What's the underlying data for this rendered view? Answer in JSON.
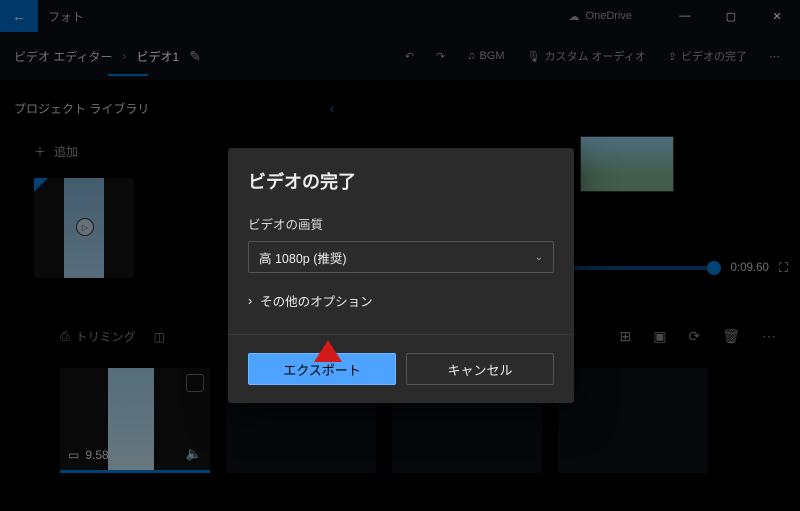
{
  "titlebar": {
    "app_name": "フォト",
    "onedrive_label": "OneDrive"
  },
  "breadcrumb": {
    "root": "ビデオ エディター",
    "current": "ビデオ1"
  },
  "commandbar": {
    "bgm_label": "BGM",
    "custom_audio_label": "カスタム オーディオ",
    "finish_video_label": "ビデオの完了"
  },
  "library": {
    "title": "プロジェクト ライブラリ",
    "add_label": "追加"
  },
  "preview": {
    "timecode": "0:09.60"
  },
  "storyboard": {
    "trimming_label": "トリミング",
    "clip_duration": "9.58"
  },
  "dialog": {
    "title": "ビデオの完了",
    "quality_label": "ビデオの画質",
    "quality_value": "高 1080p (推奨)",
    "more_options_label": "その他のオプション",
    "export_label": "エクスポート",
    "cancel_label": "キャンセル"
  }
}
